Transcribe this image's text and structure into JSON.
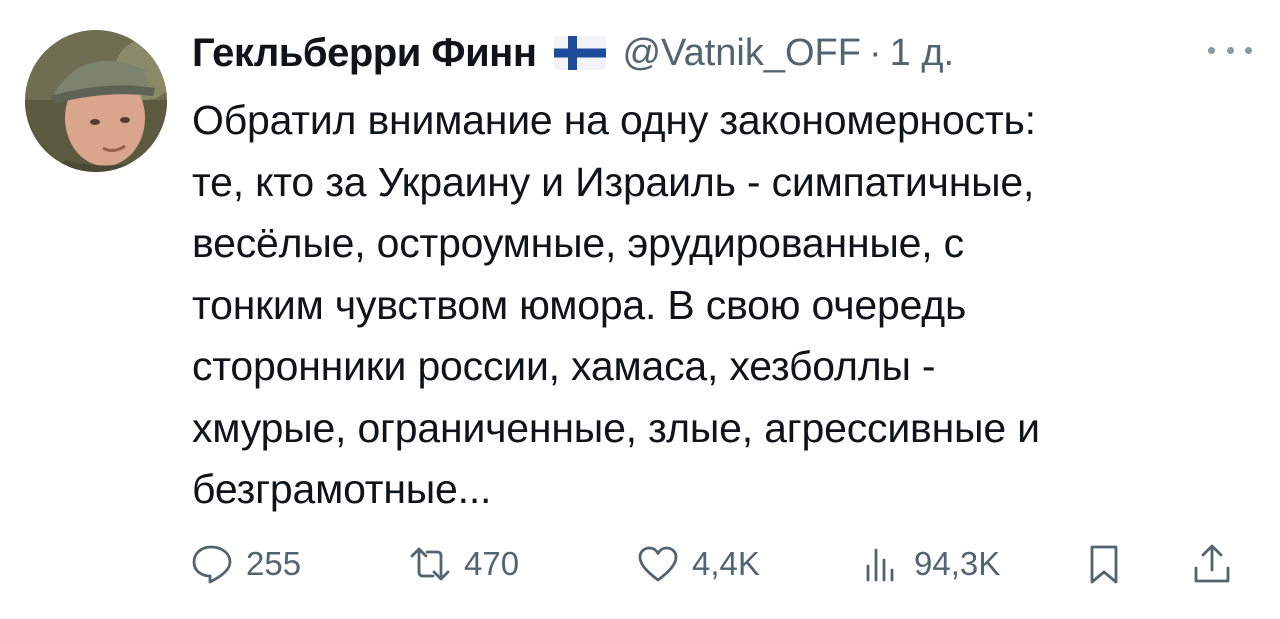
{
  "author": {
    "display_name": "Гекльберри Финн",
    "flag_icon": "finland-flag-icon",
    "handle": "@Vatnik_OFF",
    "separator": "·",
    "time": "1 д."
  },
  "tweet": {
    "text": "Обратил внимание на одну закономерность:\nте, кто за Украину и Израиль - симпатичные,\nвесёлые, остроумные, эрудированные, с\nтонким чувством юмора. В свою очередь\nсторонники россии, хамаса, хезболлы -\nхмурые, ограниченные, злые, агрессивные и\nбезграмотные..."
  },
  "actions": {
    "replies": "255",
    "reposts": "470",
    "likes": "4,4K",
    "views": "94,3K"
  },
  "icons": {
    "reply": "speech-bubble-icon",
    "repost": "repost-arrows-icon",
    "like": "heart-icon",
    "views": "bar-chart-icon",
    "bookmark": "bookmark-icon",
    "share": "share-icon",
    "more": "more-dots-icon"
  },
  "colors": {
    "text_primary": "#0f1419",
    "text_secondary": "#536471",
    "flag_blue": "#1d4d9a"
  }
}
